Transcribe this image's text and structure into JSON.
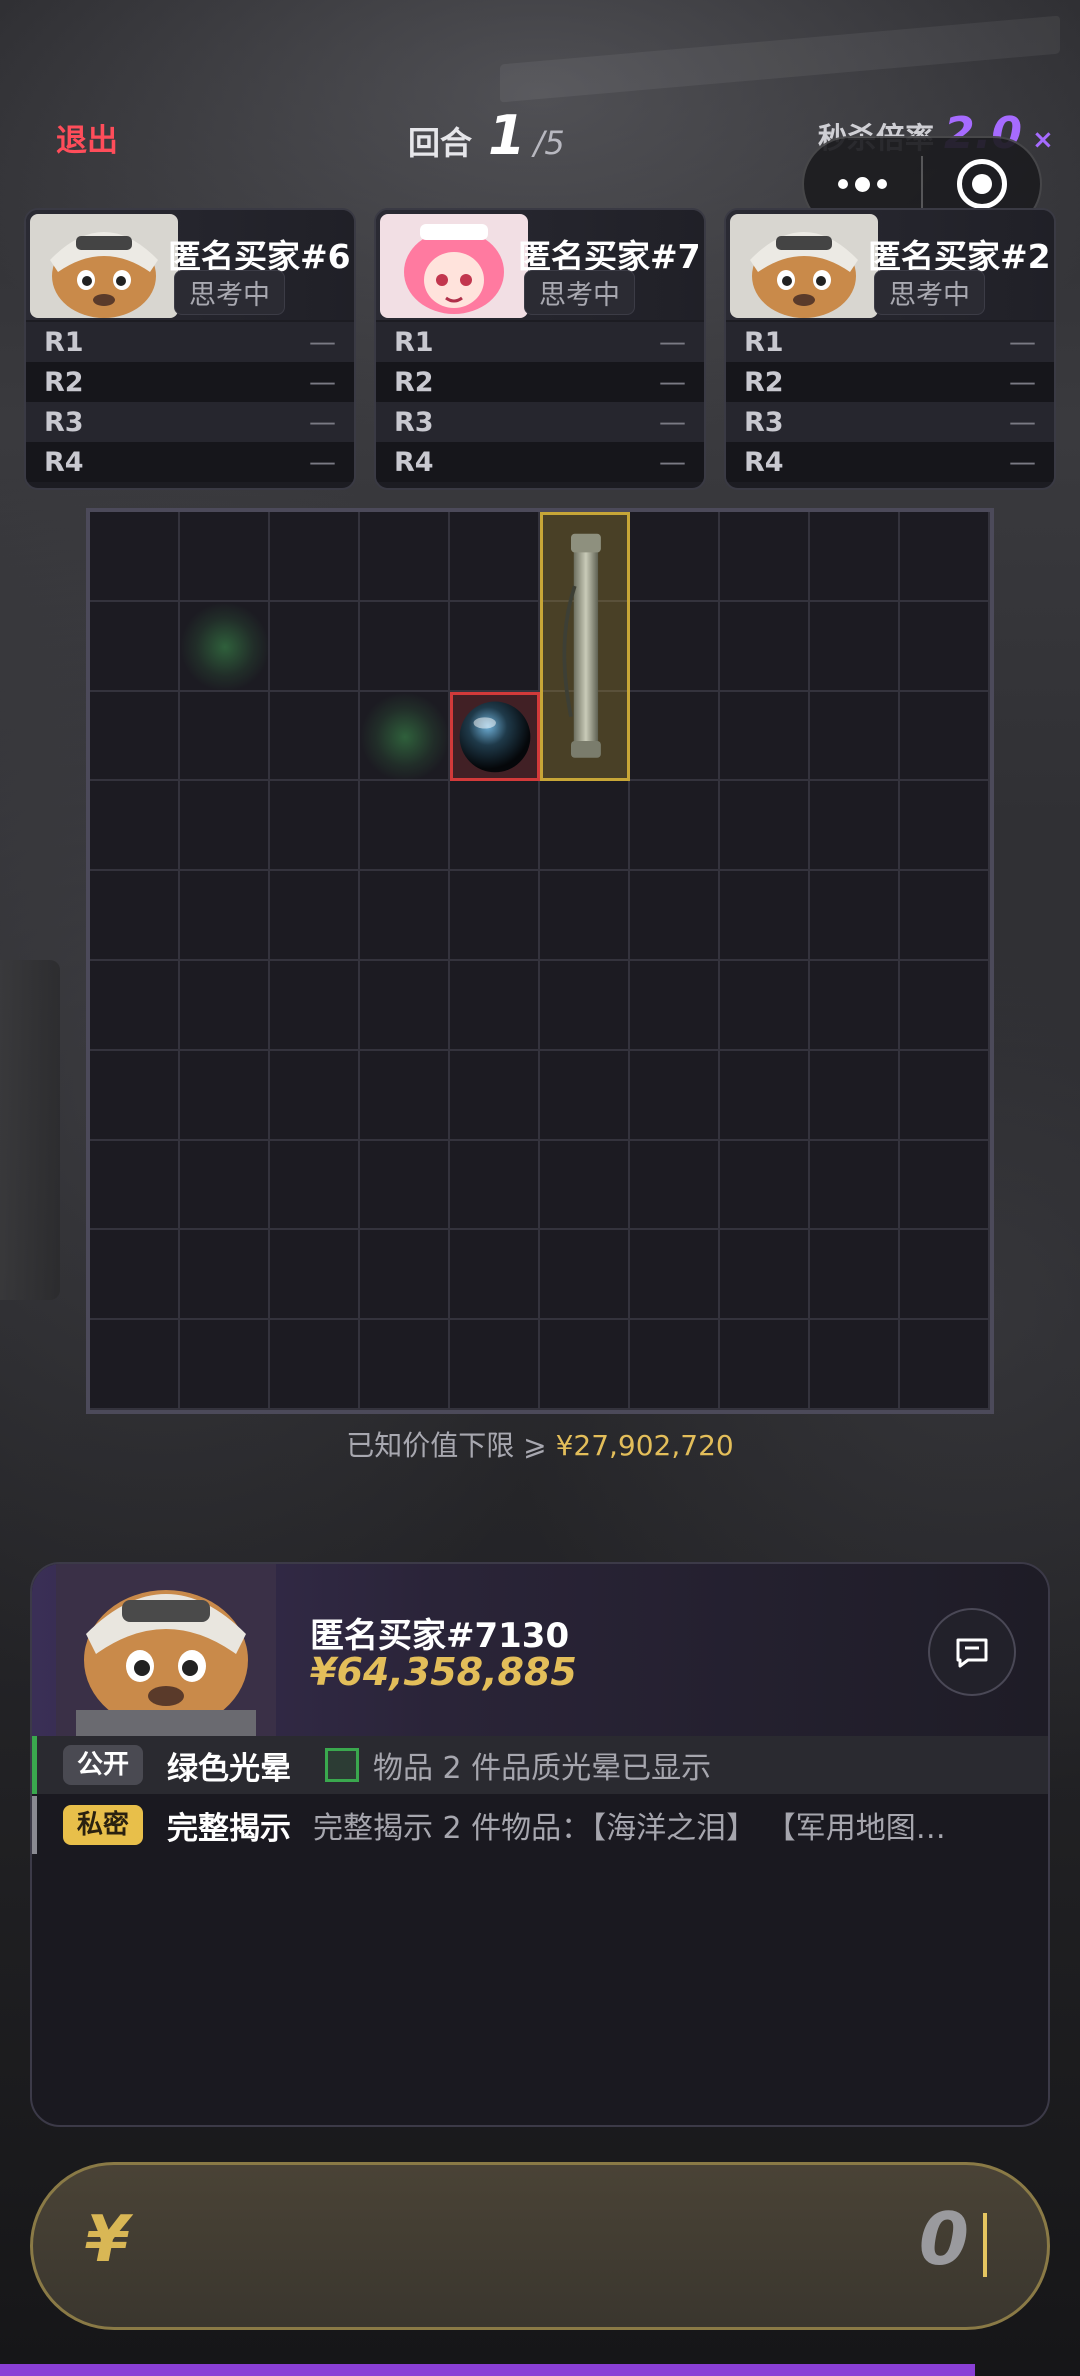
{
  "header": {
    "quit_label": "退出",
    "round_label": "回合",
    "round_current": "1",
    "round_total": "/5",
    "kill_label": "秒杀倍率",
    "kill_value": "2.0",
    "kill_suffix": "×"
  },
  "bidders": [
    {
      "name": "匿名买家#6",
      "status": "思考中",
      "avatar": "fox-pilot",
      "rows": [
        {
          "label": "R1",
          "value": "—"
        },
        {
          "label": "R2",
          "value": "—"
        },
        {
          "label": "R3",
          "value": "—"
        },
        {
          "label": "R4",
          "value": "—"
        }
      ]
    },
    {
      "name": "匿名买家#7",
      "status": "思考中",
      "avatar": "pink-maid",
      "rows": [
        {
          "label": "R1",
          "value": "—"
        },
        {
          "label": "R2",
          "value": "—"
        },
        {
          "label": "R3",
          "value": "—"
        },
        {
          "label": "R4",
          "value": "—"
        }
      ]
    },
    {
      "name": "匿名买家#2",
      "status": "思考中",
      "avatar": "fox-pilot",
      "rows": [
        {
          "label": "R1",
          "value": "—"
        },
        {
          "label": "R2",
          "value": "—"
        },
        {
          "label": "R3",
          "value": "—"
        },
        {
          "label": "R4",
          "value": "—"
        }
      ]
    }
  ],
  "grid": {
    "rows": 10,
    "cols": 10,
    "items": [
      {
        "name": "dark-orb-item",
        "rarity": "red",
        "col": 4,
        "row": 2,
        "w": 1,
        "h": 1
      },
      {
        "name": "map-tube-item",
        "rarity": "gold",
        "col": 5,
        "row": 0,
        "w": 1,
        "h": 3
      }
    ],
    "glows": [
      {
        "col": 1,
        "row": 1
      },
      {
        "col": 3,
        "row": 2
      }
    ]
  },
  "floor": {
    "label": "已知价值下限 ⩾",
    "value": "¥27,902,720"
  },
  "player": {
    "name": "匿名买家#7130",
    "money": "¥64,358,885",
    "avatar": "fox-pilot"
  },
  "log": [
    {
      "type": "public",
      "tag": "公开",
      "title": "绿色光晕",
      "desc": "物品 2 件品质光晕已显示"
    },
    {
      "type": "private",
      "tag": "私密",
      "title": "完整揭示",
      "desc": "完整揭示 2 件物品：【海洋之泪】 【军用地图…"
    }
  ],
  "bid": {
    "currency": "¥",
    "amount": "0"
  },
  "colors": {
    "accent_purple": "#a66bff",
    "gold": "#e3be5a",
    "quit_red": "#ff4d5a",
    "glow_green": "#3aa84e"
  }
}
